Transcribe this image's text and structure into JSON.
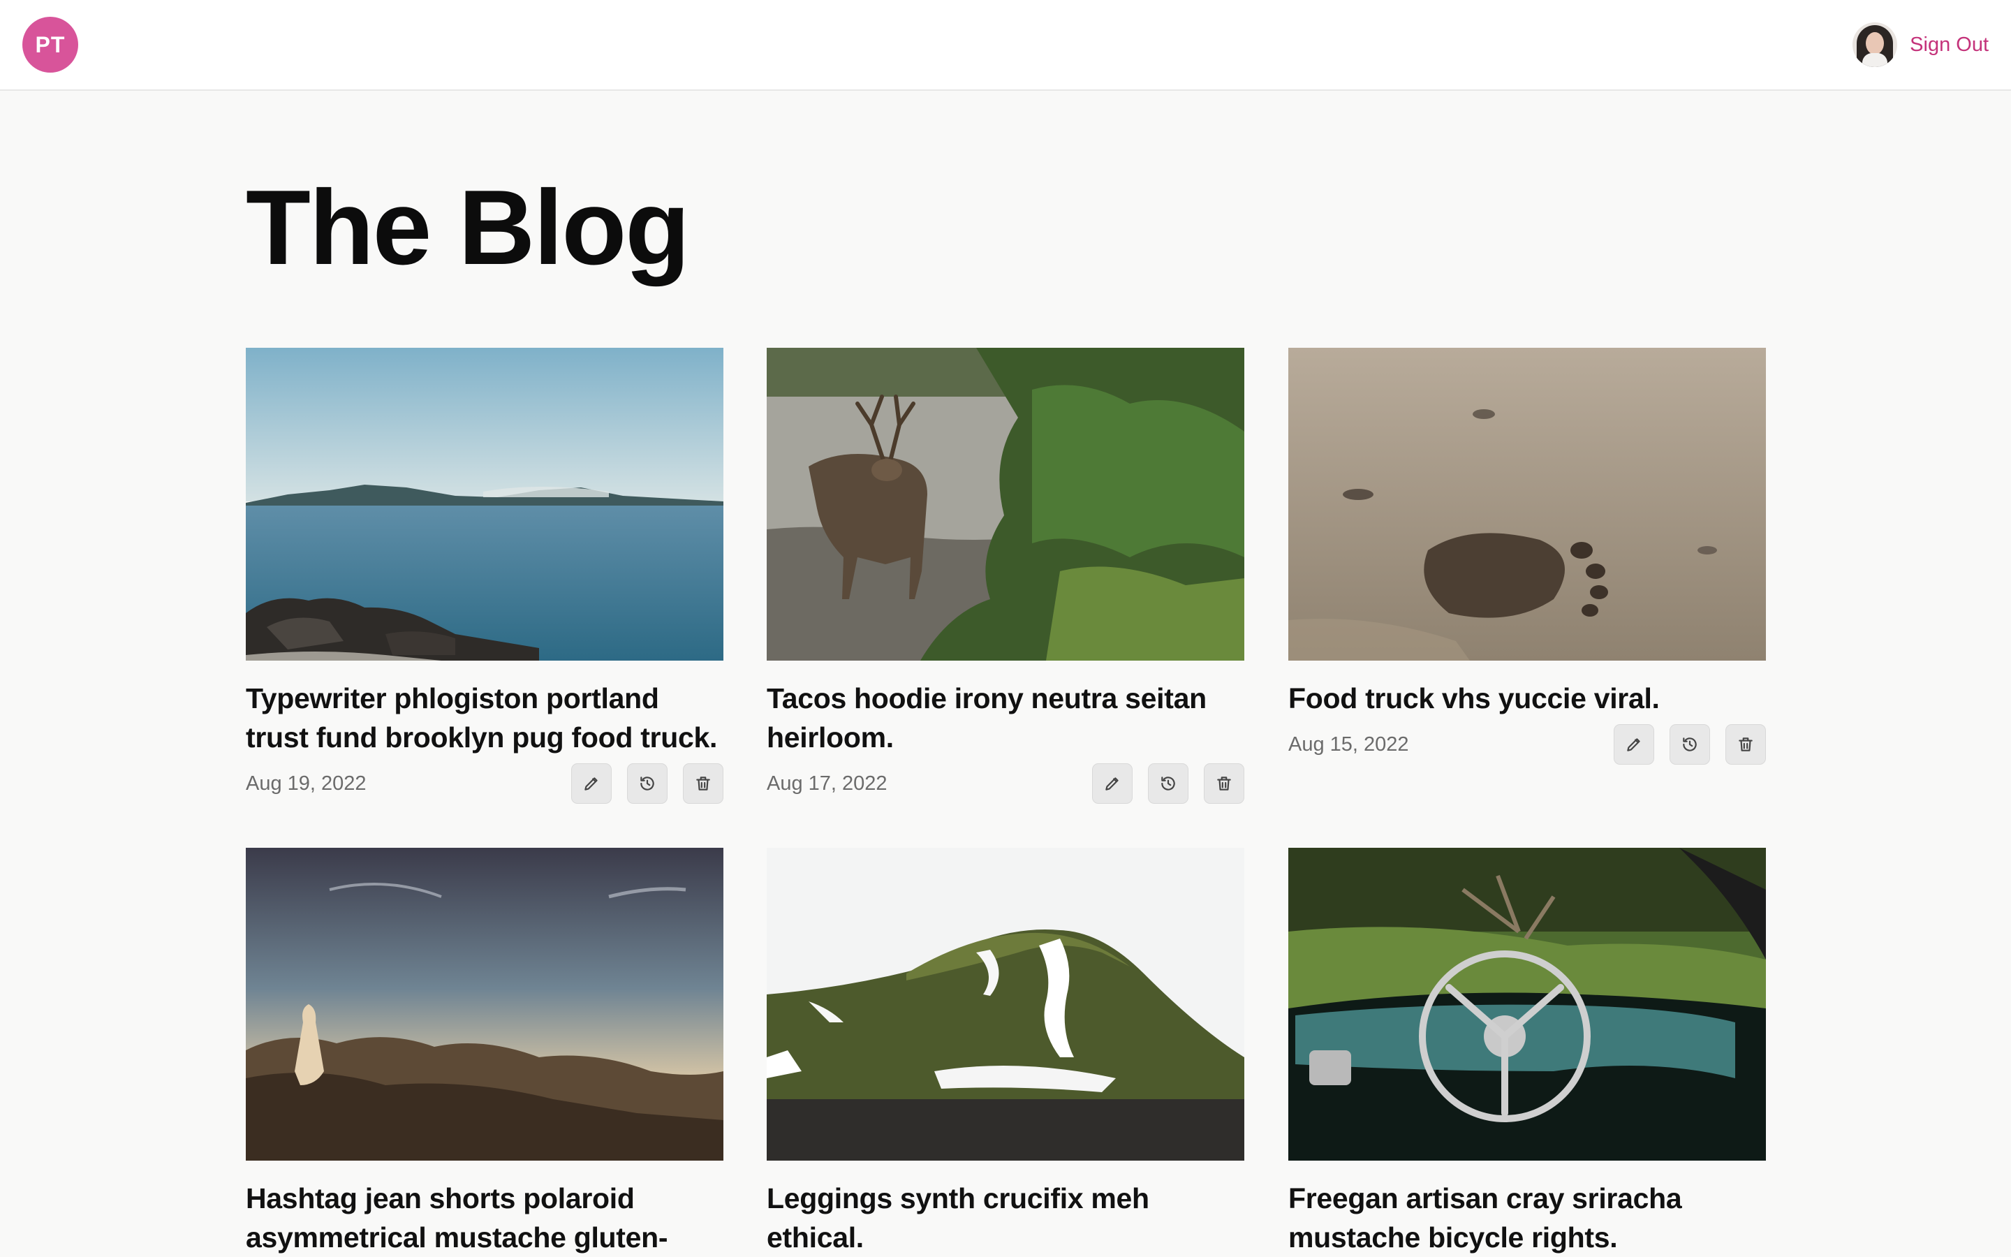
{
  "header": {
    "logo_initials": "PT",
    "sign_out_label": "Sign Out"
  },
  "page": {
    "title": "The Blog"
  },
  "posts": [
    {
      "title": "Typewriter phlogiston portland trust fund brooklyn pug food truck.",
      "date": "Aug 19, 2022"
    },
    {
      "title": "Tacos hoodie irony neutra seitan heirloom.",
      "date": "Aug 17, 2022"
    },
    {
      "title": "Food truck vhs yuccie viral.",
      "date": "Aug 15, 2022"
    },
    {
      "title": "Hashtag jean shorts polaroid asymmetrical mustache gluten-"
    },
    {
      "title": "Leggings synth crucifix meh ethical."
    },
    {
      "title": "Freegan artisan cray sriracha mustache bicycle rights."
    }
  ],
  "icons": {
    "edit": "pencil-icon",
    "history": "history-icon",
    "delete": "trash-icon"
  },
  "colors": {
    "accent": "#c4327a",
    "logo_bg": "#d8549a",
    "page_bg": "#f9f9f8"
  }
}
